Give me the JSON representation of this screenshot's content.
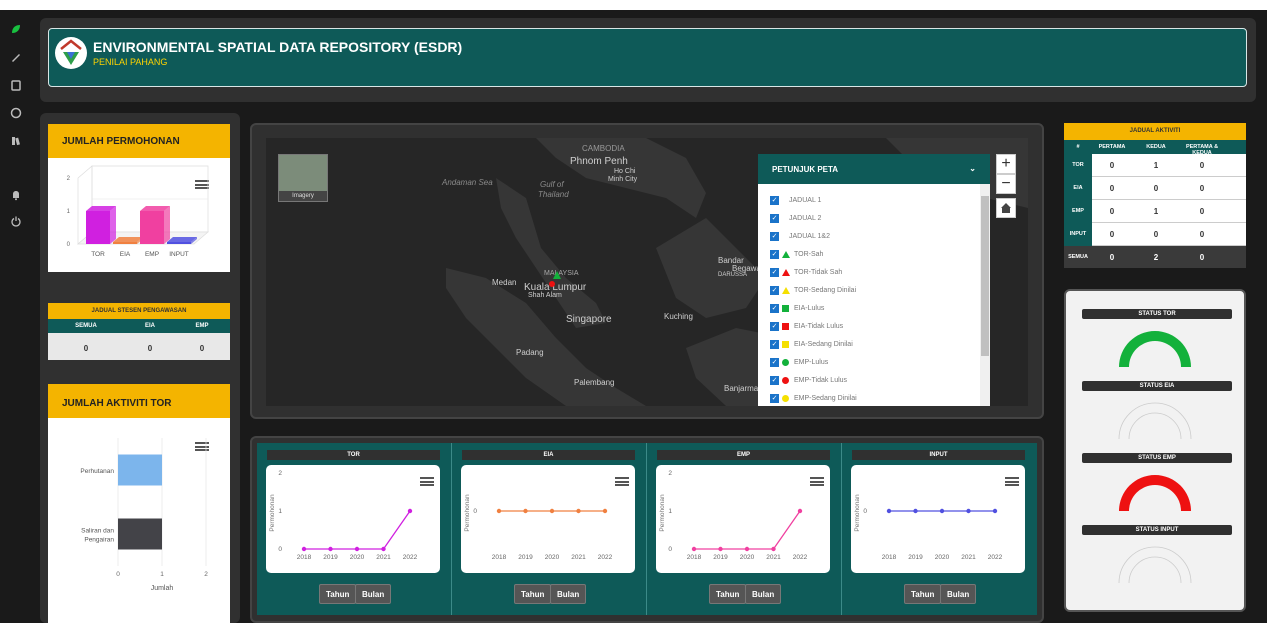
{
  "header": {
    "title": "ENVIRONMENTAL SPATIAL DATA REPOSITORY (ESDR)",
    "subtitle": "PENILAI PAHANG"
  },
  "sidebar": {
    "icons": [
      "leaf-icon",
      "pen-icon",
      "book-icon",
      "globe-icon",
      "books-icon",
      "bell-icon",
      "power-icon"
    ]
  },
  "colors": {
    "teal": "#0e5a58",
    "gold": "#f4b400",
    "tor": "#d020e0",
    "eia": "#f08040",
    "emp": "#f040a0",
    "input": "#5050e0",
    "green": "#13b13b",
    "red": "#ee1111"
  },
  "jumlah_permohonan": {
    "title": "JUMLAH PERMOHONAN",
    "chart_data": {
      "type": "bar",
      "categories": [
        "TOR",
        "EIA",
        "EMP",
        "INPUT"
      ],
      "values": [
        1,
        0,
        1,
        0
      ],
      "ylim": [
        0,
        2
      ],
      "yticks": [
        "0",
        "1",
        "2"
      ]
    }
  },
  "jadual_stesen": {
    "title": "JADUAL STESEN PENGAWASAN",
    "headers": [
      "SEMUA",
      "EIA",
      "EMP"
    ],
    "values": [
      "0",
      "0",
      "0"
    ]
  },
  "jumlah_aktiviti_tor": {
    "title": "JUMLAH AKTIVITI TOR",
    "chart_data": {
      "type": "bar",
      "categories": [
        "Perhutanan",
        "Saliran dan Pengairan"
      ],
      "values": [
        1,
        1
      ],
      "xlabel": "Jumlah",
      "xlim": [
        0,
        2
      ],
      "xticks": [
        "0",
        "1",
        "2"
      ]
    }
  },
  "map": {
    "basemap_label": "Imagery",
    "zoom_in": "+",
    "zoom_out": "−",
    "labels": {
      "cambodia": "CAMBODIA",
      "phnom_penh": "Phnom Penh",
      "ho_chi_minh": "Ho Chi",
      "ho_chi_minh_2": "Minh City",
      "andaman": "Andaman Sea",
      "gulf": "Gulf of",
      "gulf_2": "Thailand",
      "malaysia": "MALAYSIA",
      "medan": "Medan",
      "kuala_lumpur": "Kuala Lumpur",
      "shah_alam": "Shah Alam",
      "singapore": "Singapore",
      "kuching": "Kuching",
      "padang": "Padang",
      "palembang": "Palembang",
      "bandar": "Bandar",
      "begawan": "Begawan",
      "darussalam": "DARUSSA",
      "banjarmasin": "Banjarma"
    }
  },
  "legend": {
    "title": "PETUNJUK PETA",
    "items": [
      {
        "label": "JADUAL 1",
        "shape": "none",
        "color": ""
      },
      {
        "label": "JADUAL 2",
        "shape": "none",
        "color": ""
      },
      {
        "label": "JADUAL 1&2",
        "shape": "none",
        "color": ""
      },
      {
        "label": "TOR-Sah",
        "shape": "triangle",
        "color": "#13b13b"
      },
      {
        "label": "TOR-Tidak Sah",
        "shape": "triangle",
        "color": "#ee1111"
      },
      {
        "label": "TOR-Sedang Dinilai",
        "shape": "triangle",
        "color": "#f5e000"
      },
      {
        "label": "EIA-Lulus",
        "shape": "square",
        "color": "#13b13b"
      },
      {
        "label": "EIA-Tidak Lulus",
        "shape": "square",
        "color": "#ee1111"
      },
      {
        "label": "EIA-Sedang Dinilai",
        "shape": "square",
        "color": "#f5e000"
      },
      {
        "label": "EMP-Lulus",
        "shape": "circle",
        "color": "#13b13b"
      },
      {
        "label": "EMP-Tidak Lulus",
        "shape": "circle",
        "color": "#ee1111"
      },
      {
        "label": "EMP-Sedang Dinilai",
        "shape": "circle",
        "color": "#f5e000"
      }
    ]
  },
  "yearly_charts": [
    {
      "title": "TOR",
      "ylabel": "Permohonan",
      "color": "#d020e0",
      "x": [
        "2018",
        "2019",
        "2020",
        "2021",
        "2022"
      ],
      "y": [
        0,
        0,
        0,
        0,
        1
      ],
      "ylim": [
        0,
        2
      ],
      "yticks": [
        "0",
        "1",
        "2"
      ],
      "btn_year": "Tahun",
      "btn_month": "Bulan"
    },
    {
      "title": "EIA",
      "ylabel": "Permohonan",
      "color": "#f08040",
      "x": [
        "2018",
        "2019",
        "2020",
        "2021",
        "2022"
      ],
      "y": [
        0,
        0,
        0,
        0,
        0
      ],
      "ylim": [
        0,
        0
      ],
      "yticks": [
        "0"
      ],
      "btn_year": "Tahun",
      "btn_month": "Bulan"
    },
    {
      "title": "EMP",
      "ylabel": "Permohonan",
      "color": "#f040a0",
      "x": [
        "2018",
        "2019",
        "2020",
        "2021",
        "2022"
      ],
      "y": [
        0,
        0,
        0,
        0,
        1
      ],
      "ylim": [
        0,
        2
      ],
      "yticks": [
        "0",
        "1",
        "2"
      ],
      "btn_year": "Tahun",
      "btn_month": "Bulan"
    },
    {
      "title": "INPUT",
      "ylabel": "Permohonan",
      "color": "#5050e0",
      "x": [
        "2018",
        "2019",
        "2020",
        "2021",
        "2022"
      ],
      "y": [
        0,
        0,
        0,
        0,
        0
      ],
      "ylim": [
        0,
        0
      ],
      "yticks": [
        "0"
      ],
      "btn_year": "Tahun",
      "btn_month": "Bulan"
    }
  ],
  "jadual_aktiviti": {
    "title": "JADUAL AKTIVITI",
    "headers": [
      "#",
      "PERTAMA",
      "KEDUA",
      "PERTAMA & KEDUA"
    ],
    "rows": [
      {
        "label": "TOR",
        "values": [
          "0",
          "1",
          "0"
        ]
      },
      {
        "label": "EIA",
        "values": [
          "0",
          "0",
          "0"
        ]
      },
      {
        "label": "EMP",
        "values": [
          "0",
          "1",
          "0"
        ]
      },
      {
        "label": "INPUT",
        "values": [
          "0",
          "0",
          "0"
        ]
      },
      {
        "label": "SEMUA",
        "values": [
          "0",
          "2",
          "0"
        ]
      }
    ]
  },
  "status": [
    {
      "title": "STATUS TOR",
      "fill": 1,
      "color": "#13b13b"
    },
    {
      "title": "STATUS EIA",
      "fill": 0,
      "color": "#dddddd"
    },
    {
      "title": "STATUS EMP",
      "fill": 1,
      "color": "#ee1111"
    },
    {
      "title": "STATUS INPUT",
      "fill": 0,
      "color": "#dddddd"
    }
  ]
}
